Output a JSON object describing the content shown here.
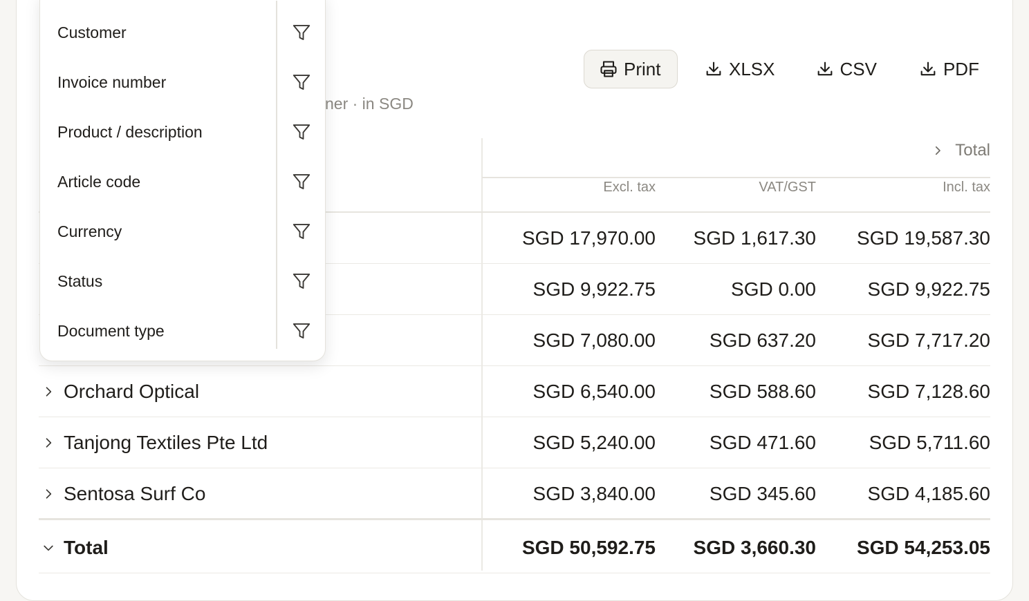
{
  "toolbar": {
    "print_label": "Print",
    "xlsx_label": "XLSX",
    "csv_label": "CSV",
    "pdf_label": "PDF"
  },
  "subtitle": "ner · in SGD",
  "table": {
    "group_header": "Total",
    "columns": [
      "Excl. tax",
      "VAT/GST",
      "Incl. tax"
    ],
    "rows": [
      {
        "name": "",
        "excl": "SGD 17,970.00",
        "vat": "SGD 1,617.30",
        "incl": "SGD 19,587.30"
      },
      {
        "name": "",
        "excl": "SGD 9,922.75",
        "vat": "SGD 0.00",
        "incl": "SGD 9,922.75"
      },
      {
        "name": "",
        "excl": "SGD 7,080.00",
        "vat": "SGD 637.20",
        "incl": "SGD 7,717.20"
      },
      {
        "name": "Orchard Optical",
        "excl": "SGD 6,540.00",
        "vat": "SGD 588.60",
        "incl": "SGD 7,128.60"
      },
      {
        "name": "Tanjong Textiles Pte Ltd",
        "excl": "SGD 5,240.00",
        "vat": "SGD 471.60",
        "incl": "SGD 5,711.60"
      },
      {
        "name": "Sentosa Surf Co",
        "excl": "SGD 3,840.00",
        "vat": "SGD 345.60",
        "incl": "SGD 4,185.60"
      }
    ],
    "total": {
      "name": "Total",
      "excl": "SGD 50,592.75",
      "vat": "SGD 3,660.30",
      "incl": "SGD 54,253.05"
    }
  },
  "dropdown": {
    "items": [
      "Customer",
      "Invoice number",
      "Product / description",
      "Article code",
      "Currency",
      "Status",
      "Document type"
    ]
  },
  "icons": {
    "print": "printer-icon",
    "download": "download-icon",
    "filter": "filter-icon",
    "expand": "chevron-right-icon",
    "collapse": "chevron-down-icon"
  },
  "colors": {
    "text": "#1f1d1a",
    "muted": "#8b8882",
    "border": "#e4e2dc"
  }
}
